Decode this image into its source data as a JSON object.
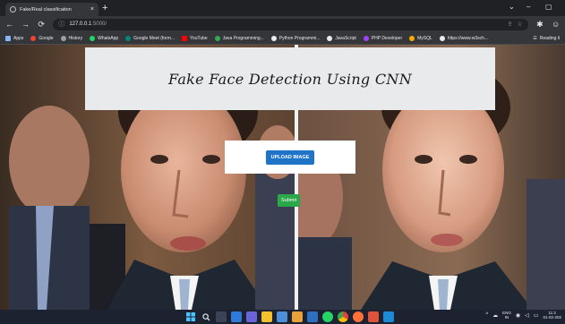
{
  "browser": {
    "tab_title": "Fake/Real classification",
    "tab_close": "×",
    "new_tab": "+",
    "window_controls": {
      "minimize": "–",
      "restore": "▢",
      "chevron": "⌄"
    },
    "url": "127.0.0.1",
    "url_port": ":5000/",
    "bookmarks": [
      {
        "label": "Apps",
        "color": "#8ab4f8"
      },
      {
        "label": "Google",
        "color": "#ea4335"
      },
      {
        "label": "History",
        "color": "#9aa0a6"
      },
      {
        "label": "WhatsApp",
        "color": "#25d366"
      },
      {
        "label": "Google Meet (form...",
        "color": "#00897b"
      },
      {
        "label": "YouTube",
        "color": "#ff0000"
      },
      {
        "label": "Java Programming...",
        "color": "#34a853"
      },
      {
        "label": "Python Programmi...",
        "color": "#e8eaed"
      },
      {
        "label": "JavaScript",
        "color": "#e8eaed"
      },
      {
        "label": "PHP Developer",
        "color": "#a142f4"
      },
      {
        "label": "MySQL",
        "color": "#f9ab00"
      },
      {
        "label": "https://www.w3sch...",
        "color": "#e8eaed"
      }
    ],
    "reading_list": "Reading li"
  },
  "page": {
    "title": "Fake Face Detection Using CNN",
    "upload_label": "UPLOAD IMAGE",
    "submit_label": "Submit"
  },
  "taskbar": {
    "lang_line1": "ENG",
    "lang_line2": "IN",
    "time": "11:2",
    "date": "01-02-202"
  },
  "colors": {
    "upload_button": "#1f74c8",
    "submit_button": "#2aa84a",
    "header_card": "#e9eaec",
    "browser_chrome": "#35363a"
  }
}
